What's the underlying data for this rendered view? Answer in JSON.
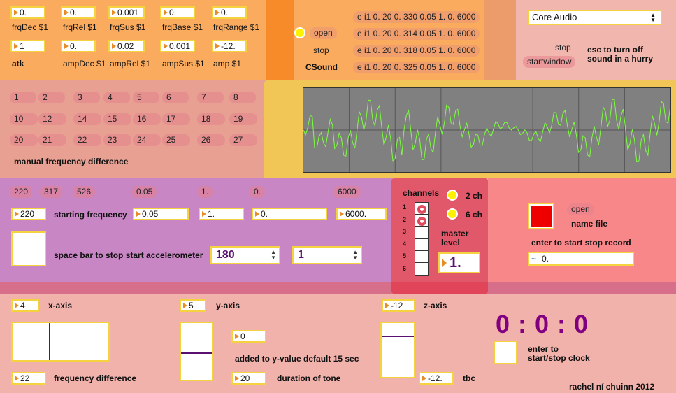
{
  "envelope": {
    "row1": [
      {
        "value": "0.",
        "label": "frqDec $1"
      },
      {
        "value": "0.",
        "label": "frqRel $1"
      },
      {
        "value": "0.001",
        "label": "frqSus $1"
      },
      {
        "value": "0.",
        "label": "frqBase $1"
      },
      {
        "value": "0.",
        "label": "frqRange $1"
      }
    ],
    "row2": [
      {
        "value": "1",
        "label": "atk"
      },
      {
        "value": "0.",
        "label": "ampDec $1"
      },
      {
        "value": "0.02",
        "label": "ampRel $1"
      },
      {
        "value": "0.001",
        "label": "ampSus $1"
      },
      {
        "value": "-12.",
        "label": "amp $1"
      }
    ]
  },
  "csound": {
    "open_label": "open",
    "stop_label": "stop",
    "title": "CSound",
    "scores": [
      "e i1 0. 20 0. 330 0.05 1. 0. 6000",
      "e i1 0. 20 0. 314 0.05 1. 0. 6000",
      "e i1 0. 20 0. 318 0.05 1. 0. 6000",
      "e i1 0. 20 0. 325 0.05 1. 0. 6000"
    ]
  },
  "audio": {
    "driver": "Core Audio",
    "stop_label": "stop",
    "startwindow_label": "startwindow",
    "esc_note_1": "esc to turn off",
    "esc_note_2": "sound in a hurry"
  },
  "manual": {
    "rows": [
      [
        "1",
        "2",
        "3",
        "4",
        "5",
        "6",
        "7",
        "8"
      ],
      [
        "10",
        "12",
        "14",
        "15",
        "16",
        "17",
        "18",
        "19"
      ],
      [
        "20",
        "21",
        "22",
        "23",
        "24",
        "25",
        "26",
        "27"
      ]
    ],
    "label": "manual frequency difference"
  },
  "synth": {
    "messages": [
      "220",
      "317",
      "526",
      "0.05",
      "1.",
      "0.",
      "6000"
    ],
    "start_freq": "220",
    "start_freq_label": "starting frequency",
    "p1": "0.05",
    "p2": "1.",
    "p3": "0.",
    "p4": "6000.",
    "accel_label": "space bar to stop start accelerometer",
    "num1": "180",
    "num2": "1"
  },
  "channels": {
    "title": "channels",
    "opt2": "2 ch",
    "opt6": "6 ch",
    "numbers": [
      "1",
      "2",
      "3",
      "4",
      "5",
      "6"
    ],
    "master_1": "master",
    "master_2": "level",
    "master_value": "1."
  },
  "record": {
    "open_label": "open",
    "name_label": "name file",
    "instruction": "enter to start stop record",
    "value": "0."
  },
  "axes": {
    "x_value": "4",
    "x_label": "x-axis",
    "y_value": "5",
    "y_label": "y-axis",
    "z_value": "-12",
    "z_label": "z-axis",
    "freq_diff": "22",
    "freq_diff_label": "frequency difference",
    "added": "0",
    "added_label": "added to y-value default 15 sec",
    "duration": "20",
    "duration_label": "duration of tone",
    "tbc": "-12.",
    "tbc_label": "tbc"
  },
  "clock": {
    "display": "0 : 0 : 0",
    "label_1": "enter to",
    "label_2": "start/stop clock"
  },
  "credit": "rachel ní chuinn 2012",
  "colors": {
    "orange": "#fbab5d",
    "purple": "#c886c4",
    "red_record": "#ee0000",
    "clock_text": "#800080",
    "scope_wave": "#7cff3c"
  }
}
